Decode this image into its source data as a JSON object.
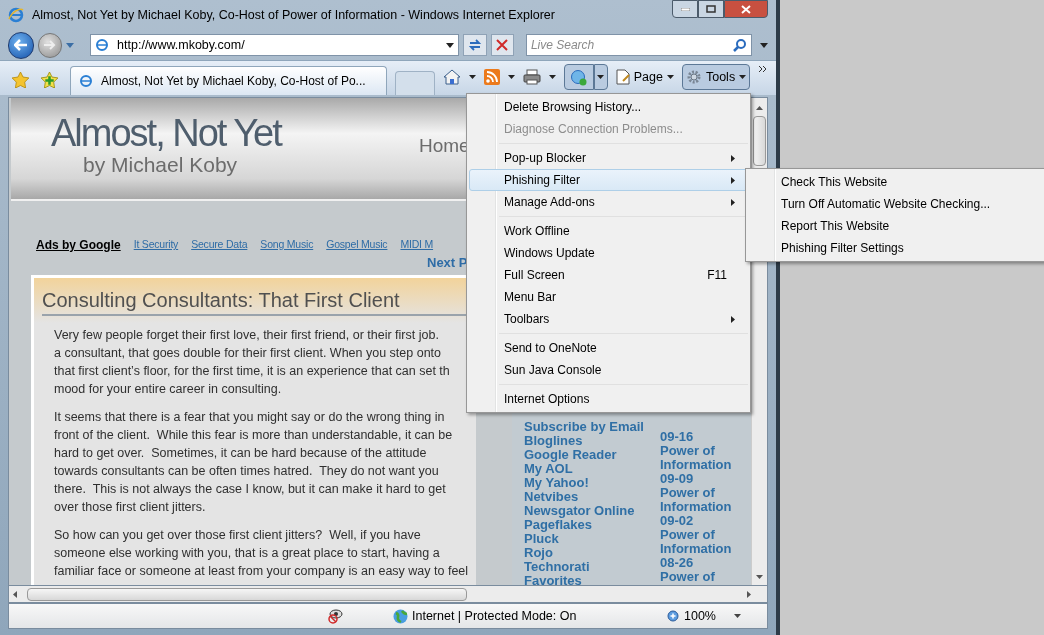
{
  "window": {
    "title": "Almost, Not Yet by Michael Koby, Co-Host of Power of Information - Windows Internet Explorer"
  },
  "address_bar": {
    "url": "http://www.mkoby.com/",
    "search_placeholder": "Live Search"
  },
  "tab": {
    "title": "Almost, Not Yet by Michael Koby, Co-Host of Po...",
    "selected": true
  },
  "command_bar": {
    "buttons": [
      {
        "label": "Page",
        "pressed": false
      },
      {
        "label": "Tools",
        "pressed": true
      }
    ]
  },
  "page": {
    "site_title": "Almost, Not Yet",
    "site_subtitle": "by Michael Koby",
    "nav": "Home",
    "ads_label": "Ads by Google",
    "ads": [
      "It Security",
      "Secure Data",
      "Song Music",
      "Gospel Music",
      "MIDI M"
    ],
    "next_link": "Next P",
    "post_title": "Consulting Consultants: That First Client",
    "paragraphs": [
      [
        "Very few people forget their first love, their first friend, or their first job.",
        "a consultant, that goes double for their first client. When you step onto",
        "that first client’s floor, for the first time, it is an experience that can set th",
        "mood for your entire career in consulting."
      ],
      [
        "It seems that there is a fear that you might say or do the wrong thing in",
        "front of the client.  While this fear is more than understandable, it can be",
        "hard to get over.  Sometimes, it can be hard because of the attitude",
        "towards consultants can be often times hatred.  They do not want you",
        "there.  This is not always the case I know, but it can make it hard to get",
        "over those first client jitters."
      ],
      [
        "So how can you get over those first client jitters?  Well, if you have",
        "someone else working with you, that is a great place to start, having a",
        "familiar face or someone at least from your company is an easy way to feel"
      ]
    ],
    "subscribe_links": [
      "Subscribe by Email",
      "Bloglines",
      "Google Reader",
      "My AOL",
      "My Yahoo!",
      "Netvibes",
      "Newsgator Online",
      "Pageflakes",
      "Pluck",
      "Rojo",
      "Technorati",
      "Favorites"
    ],
    "column_2": [
      "09-16",
      "Power of",
      "Information",
      "09-09",
      "Power of",
      "Information",
      "09-02",
      "Power of",
      "Information",
      "08-26",
      "Power of"
    ]
  },
  "tools_menu": {
    "groups": [
      [
        {
          "label": "Delete Browsing History...",
          "disabled": false,
          "submenu": false,
          "selected": false
        },
        {
          "label": "Diagnose Connection Problems...",
          "disabled": true,
          "submenu": false,
          "selected": false
        }
      ],
      [
        {
          "label": "Pop-up Blocker",
          "disabled": false,
          "submenu": true,
          "selected": false
        },
        {
          "label": "Phishing Filter",
          "disabled": false,
          "submenu": true,
          "selected": true
        },
        {
          "label": "Manage Add-ons",
          "disabled": false,
          "submenu": true,
          "selected": false
        }
      ],
      [
        {
          "label": "Work Offline",
          "disabled": false,
          "submenu": false,
          "selected": false
        },
        {
          "label": "Windows Update",
          "disabled": false,
          "submenu": false,
          "selected": false
        },
        {
          "label": "Full Screen",
          "shortcut": "F11",
          "disabled": false,
          "submenu": false,
          "selected": false
        },
        {
          "label": "Menu Bar",
          "disabled": false,
          "submenu": false,
          "selected": false
        },
        {
          "label": "Toolbars",
          "disabled": false,
          "submenu": true,
          "selected": false
        }
      ],
      [
        {
          "label": "Send to OneNote",
          "disabled": false,
          "submenu": false,
          "selected": false
        },
        {
          "label": "Sun Java Console",
          "disabled": false,
          "submenu": false,
          "selected": false
        }
      ],
      [
        {
          "label": "Internet Options",
          "disabled": false,
          "submenu": false,
          "selected": false
        }
      ]
    ]
  },
  "phishing_submenu": {
    "items": [
      "Check This Website",
      "Turn Off Automatic Website Checking...",
      "Report This Website",
      "Phishing Filter Settings"
    ]
  },
  "status_bar": {
    "zone": "Internet | Protected Mode: On",
    "zoom": "100%"
  }
}
